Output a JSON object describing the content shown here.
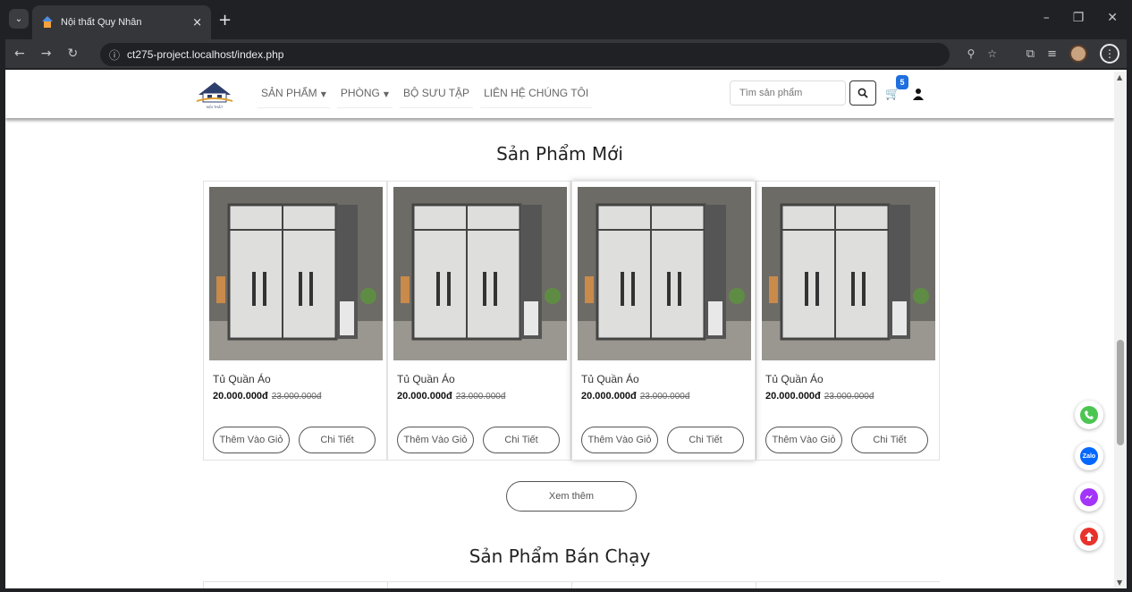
{
  "browser": {
    "tab_title": "Nội thất Quy Nhân",
    "url": "ct275-project.localhost/index.php"
  },
  "header": {
    "logo_text": "NỘI THẤT",
    "menu": [
      {
        "label": "SẢN PHẨM",
        "has_dropdown": true
      },
      {
        "label": "PHÒNG",
        "has_dropdown": true
      },
      {
        "label": "BỘ SƯU TẬP",
        "has_dropdown": false
      },
      {
        "label": "LIÊN HỆ CHÚNG TÔI",
        "has_dropdown": false
      }
    ],
    "search_placeholder": "Tìm sản phẩm",
    "cart_count": "5"
  },
  "new_products": {
    "title": "Sản Phẩm Mới",
    "products": [
      {
        "name": "Tủ Quần Áo",
        "price": "20.000.000đ",
        "old_price": "23.000.000đ",
        "add_label": "Thêm Vào Giỏ",
        "detail_label": "Chi Tiết"
      },
      {
        "name": "Tủ Quần Áo",
        "price": "20.000.000đ",
        "old_price": "23.000.000đ",
        "add_label": "Thêm Vào Giỏ",
        "detail_label": "Chi Tiết"
      },
      {
        "name": "Tủ Quần Áo",
        "price": "20.000.000đ",
        "old_price": "23.000.000đ",
        "add_label": "Thêm Vào Giỏ",
        "detail_label": "Chi Tiết"
      },
      {
        "name": "Tủ Quần Áo",
        "price": "20.000.000đ",
        "old_price": "23.000.000đ",
        "add_label": "Thêm Vào Giỏ",
        "detail_label": "Chi Tiết"
      }
    ],
    "more_label": "Xem thêm"
  },
  "best_sellers": {
    "title": "Sản Phẩm Bán Chạy"
  },
  "floating_buttons": [
    {
      "name": "phone-icon",
      "color": "#4cc552"
    },
    {
      "name": "zalo-icon",
      "color": "#0068ff",
      "text": "Zalo"
    },
    {
      "name": "messenger-icon",
      "color": "#a334fa"
    },
    {
      "name": "scroll-top-icon",
      "color": "#e8322c"
    }
  ]
}
